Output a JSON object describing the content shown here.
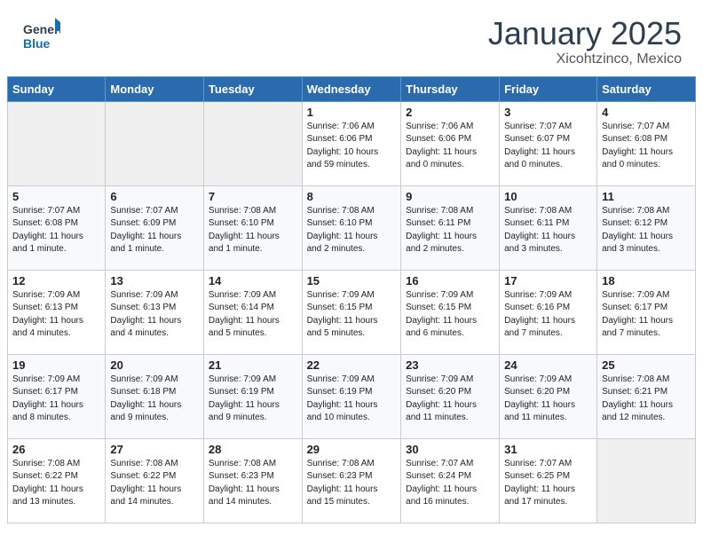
{
  "header": {
    "logo_line1": "General",
    "logo_line2": "Blue",
    "month": "January 2025",
    "location": "Xicohtzinco, Mexico"
  },
  "weekdays": [
    "Sunday",
    "Monday",
    "Tuesday",
    "Wednesday",
    "Thursday",
    "Friday",
    "Saturday"
  ],
  "weeks": [
    [
      {
        "day": "",
        "info": ""
      },
      {
        "day": "",
        "info": ""
      },
      {
        "day": "",
        "info": ""
      },
      {
        "day": "1",
        "info": "Sunrise: 7:06 AM\nSunset: 6:06 PM\nDaylight: 10 hours\nand 59 minutes."
      },
      {
        "day": "2",
        "info": "Sunrise: 7:06 AM\nSunset: 6:06 PM\nDaylight: 11 hours\nand 0 minutes."
      },
      {
        "day": "3",
        "info": "Sunrise: 7:07 AM\nSunset: 6:07 PM\nDaylight: 11 hours\nand 0 minutes."
      },
      {
        "day": "4",
        "info": "Sunrise: 7:07 AM\nSunset: 6:08 PM\nDaylight: 11 hours\nand 0 minutes."
      }
    ],
    [
      {
        "day": "5",
        "info": "Sunrise: 7:07 AM\nSunset: 6:08 PM\nDaylight: 11 hours\nand 1 minute."
      },
      {
        "day": "6",
        "info": "Sunrise: 7:07 AM\nSunset: 6:09 PM\nDaylight: 11 hours\nand 1 minute."
      },
      {
        "day": "7",
        "info": "Sunrise: 7:08 AM\nSunset: 6:10 PM\nDaylight: 11 hours\nand 1 minute."
      },
      {
        "day": "8",
        "info": "Sunrise: 7:08 AM\nSunset: 6:10 PM\nDaylight: 11 hours\nand 2 minutes."
      },
      {
        "day": "9",
        "info": "Sunrise: 7:08 AM\nSunset: 6:11 PM\nDaylight: 11 hours\nand 2 minutes."
      },
      {
        "day": "10",
        "info": "Sunrise: 7:08 AM\nSunset: 6:11 PM\nDaylight: 11 hours\nand 3 minutes."
      },
      {
        "day": "11",
        "info": "Sunrise: 7:08 AM\nSunset: 6:12 PM\nDaylight: 11 hours\nand 3 minutes."
      }
    ],
    [
      {
        "day": "12",
        "info": "Sunrise: 7:09 AM\nSunset: 6:13 PM\nDaylight: 11 hours\nand 4 minutes."
      },
      {
        "day": "13",
        "info": "Sunrise: 7:09 AM\nSunset: 6:13 PM\nDaylight: 11 hours\nand 4 minutes."
      },
      {
        "day": "14",
        "info": "Sunrise: 7:09 AM\nSunset: 6:14 PM\nDaylight: 11 hours\nand 5 minutes."
      },
      {
        "day": "15",
        "info": "Sunrise: 7:09 AM\nSunset: 6:15 PM\nDaylight: 11 hours\nand 5 minutes."
      },
      {
        "day": "16",
        "info": "Sunrise: 7:09 AM\nSunset: 6:15 PM\nDaylight: 11 hours\nand 6 minutes."
      },
      {
        "day": "17",
        "info": "Sunrise: 7:09 AM\nSunset: 6:16 PM\nDaylight: 11 hours\nand 7 minutes."
      },
      {
        "day": "18",
        "info": "Sunrise: 7:09 AM\nSunset: 6:17 PM\nDaylight: 11 hours\nand 7 minutes."
      }
    ],
    [
      {
        "day": "19",
        "info": "Sunrise: 7:09 AM\nSunset: 6:17 PM\nDaylight: 11 hours\nand 8 minutes."
      },
      {
        "day": "20",
        "info": "Sunrise: 7:09 AM\nSunset: 6:18 PM\nDaylight: 11 hours\nand 9 minutes."
      },
      {
        "day": "21",
        "info": "Sunrise: 7:09 AM\nSunset: 6:19 PM\nDaylight: 11 hours\nand 9 minutes."
      },
      {
        "day": "22",
        "info": "Sunrise: 7:09 AM\nSunset: 6:19 PM\nDaylight: 11 hours\nand 10 minutes."
      },
      {
        "day": "23",
        "info": "Sunrise: 7:09 AM\nSunset: 6:20 PM\nDaylight: 11 hours\nand 11 minutes."
      },
      {
        "day": "24",
        "info": "Sunrise: 7:09 AM\nSunset: 6:20 PM\nDaylight: 11 hours\nand 11 minutes."
      },
      {
        "day": "25",
        "info": "Sunrise: 7:08 AM\nSunset: 6:21 PM\nDaylight: 11 hours\nand 12 minutes."
      }
    ],
    [
      {
        "day": "26",
        "info": "Sunrise: 7:08 AM\nSunset: 6:22 PM\nDaylight: 11 hours\nand 13 minutes."
      },
      {
        "day": "27",
        "info": "Sunrise: 7:08 AM\nSunset: 6:22 PM\nDaylight: 11 hours\nand 14 minutes."
      },
      {
        "day": "28",
        "info": "Sunrise: 7:08 AM\nSunset: 6:23 PM\nDaylight: 11 hours\nand 14 minutes."
      },
      {
        "day": "29",
        "info": "Sunrise: 7:08 AM\nSunset: 6:23 PM\nDaylight: 11 hours\nand 15 minutes."
      },
      {
        "day": "30",
        "info": "Sunrise: 7:07 AM\nSunset: 6:24 PM\nDaylight: 11 hours\nand 16 minutes."
      },
      {
        "day": "31",
        "info": "Sunrise: 7:07 AM\nSunset: 6:25 PM\nDaylight: 11 hours\nand 17 minutes."
      },
      {
        "day": "",
        "info": ""
      }
    ]
  ]
}
